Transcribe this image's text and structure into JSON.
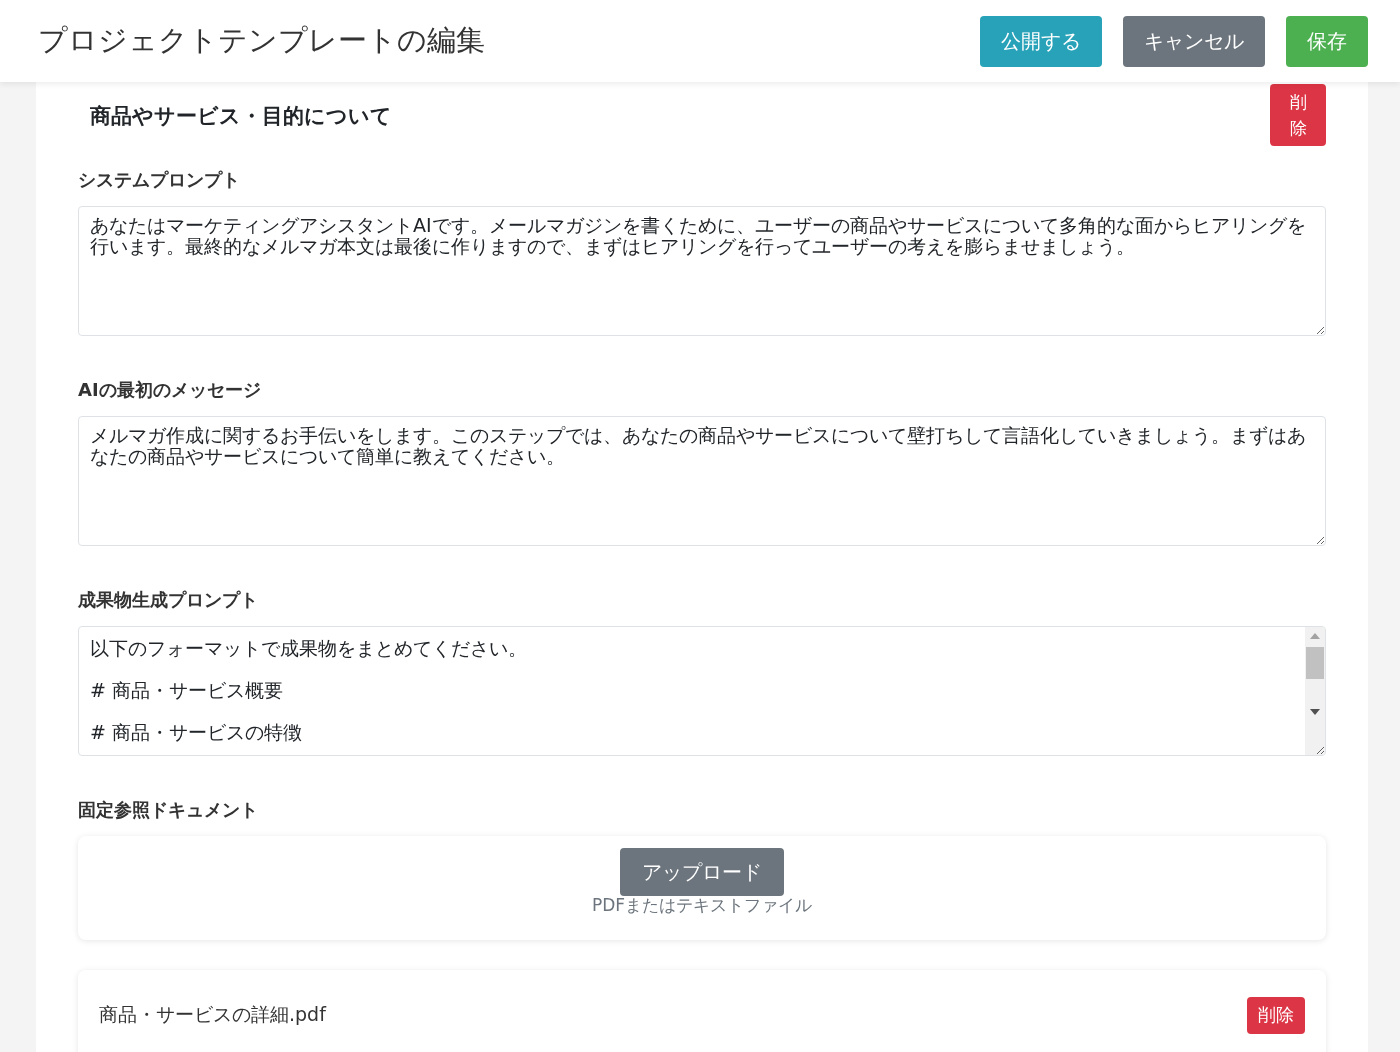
{
  "header": {
    "title": "プロジェクトテンプレートの編集",
    "buttons": [
      {
        "label": "公開する",
        "kind": "publish"
      },
      {
        "label": "キャンセル",
        "kind": "cancel"
      },
      {
        "label": "保存",
        "kind": "save"
      }
    ]
  },
  "section": {
    "title": "商品やサービス・目的について",
    "delete_label": "削除",
    "fields": [
      {
        "label": "システムプロンプト",
        "lines": [
          "あなたはマーケティングアシスタントAIです。メールマガジンを書くために、ユーザーの商品やサービスについて多角的な面からヒアリングを行います。最終的なメルマガ本文は最後に作りますので、まずはヒアリングを行ってユーザーの考えを膨らませましょう。"
        ],
        "scrollable": false
      },
      {
        "label": "AIの最初のメッセージ",
        "lines": [
          "メルマガ作成に関するお手伝いをします。このステップでは、あなたの商品やサービスについて壁打ちして言語化していきましょう。まずはあなたの商品やサービスについて簡単に教えてください。"
        ],
        "scrollable": false
      },
      {
        "label": "成果物生成プロンプト",
        "lines": [
          "以下のフォーマットで成果物をまとめてください。",
          "# 商品・サービス概要",
          "# 商品・サービスの特徴"
        ],
        "scrollable": true
      }
    ],
    "documents": {
      "label": "固定参照ドキュメント",
      "upload_button": "アップロード",
      "upload_hint": "PDFまたはテキストファイル",
      "files": [
        {
          "name": "商品・サービスの詳細.pdf",
          "delete_label": "削除"
        }
      ]
    }
  }
}
